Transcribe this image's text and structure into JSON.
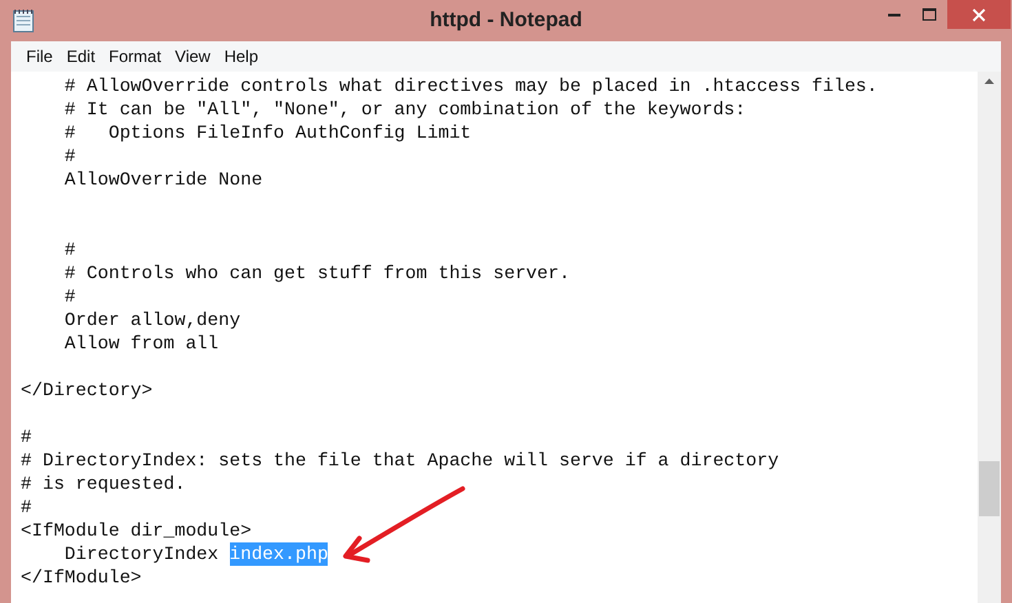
{
  "window": {
    "title": "httpd - Notepad"
  },
  "menu": [
    "File",
    "Edit",
    "Format",
    "View",
    "Help"
  ],
  "lines": [
    {
      "kind": "text",
      "text": "    # AllowOverride controls what directives may be placed in .htaccess files."
    },
    {
      "kind": "text",
      "text": "    # It can be \"All\", \"None\", or any combination of the keywords:"
    },
    {
      "kind": "text",
      "text": "    #   Options FileInfo AuthConfig Limit"
    },
    {
      "kind": "text",
      "text": "    #"
    },
    {
      "kind": "text",
      "text": "    AllowOverride None"
    },
    {
      "kind": "blank"
    },
    {
      "kind": "blank"
    },
    {
      "kind": "text",
      "text": "    #"
    },
    {
      "kind": "text",
      "text": "    # Controls who can get stuff from this server."
    },
    {
      "kind": "text",
      "text": "    #"
    },
    {
      "kind": "text",
      "text": "    Order allow,deny"
    },
    {
      "kind": "text",
      "text": "    Allow from all"
    },
    {
      "kind": "blank"
    },
    {
      "kind": "text",
      "text": "</Directory>"
    },
    {
      "kind": "blank"
    },
    {
      "kind": "text",
      "text": "#"
    },
    {
      "kind": "text",
      "text": "# DirectoryIndex: sets the file that Apache will serve if a directory"
    },
    {
      "kind": "text",
      "text": "# is requested."
    },
    {
      "kind": "text",
      "text": "#"
    },
    {
      "kind": "text",
      "text": "<IfModule dir_module>"
    },
    {
      "kind": "segments",
      "segments": [
        {
          "text": "    DirectoryIndex ",
          "selected": false
        },
        {
          "text": "index.php",
          "selected": true
        }
      ]
    },
    {
      "kind": "text",
      "text": "</IfModule>"
    }
  ]
}
